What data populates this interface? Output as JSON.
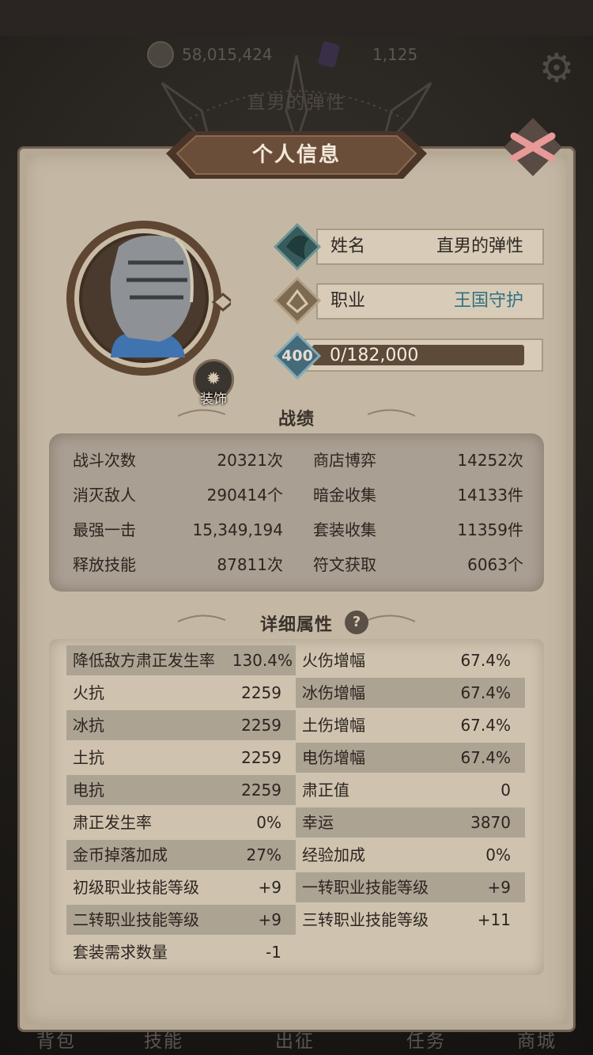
{
  "currency": {
    "gold": "58,015,424",
    "gems": "1,125"
  },
  "background_title": "直男的弹性",
  "panel": {
    "title": "个人信息"
  },
  "profile": {
    "decorate_label": "装饰",
    "name_label": "姓名",
    "name_value": "直男的弹性",
    "job_label": "职业",
    "job_value": "王国守护",
    "level": "400",
    "exp": "0/182,000",
    "exp_progress": 0
  },
  "records": {
    "title": "战绩",
    "items": [
      {
        "label": "战斗次数",
        "value": "20321次"
      },
      {
        "label": "商店博弈",
        "value": "14252次"
      },
      {
        "label": "消灭敌人",
        "value": "290414个"
      },
      {
        "label": "暗金收集",
        "value": "14133件"
      },
      {
        "label": "最强一击",
        "value": "15,349,194"
      },
      {
        "label": "套装收集",
        "value": "11359件"
      },
      {
        "label": "释放技能",
        "value": "87811次"
      },
      {
        "label": "符文获取",
        "value": "6063个"
      }
    ]
  },
  "attributes": {
    "title": "详细属性",
    "help": "?",
    "left": [
      {
        "label": "降低敌方肃正发生率",
        "value": "130.4%"
      },
      {
        "label": "火抗",
        "value": "2259"
      },
      {
        "label": "冰抗",
        "value": "2259"
      },
      {
        "label": "土抗",
        "value": "2259"
      },
      {
        "label": "电抗",
        "value": "2259"
      },
      {
        "label": "肃正发生率",
        "value": "0%"
      },
      {
        "label": "金币掉落加成",
        "value": "27%"
      },
      {
        "label": "初级职业技能等级",
        "value": "+9"
      },
      {
        "label": "二转职业技能等级",
        "value": "+9"
      },
      {
        "label": "套装需求数量",
        "value": "-1"
      }
    ],
    "right": [
      {
        "label": "火伤增幅",
        "value": "67.4%"
      },
      {
        "label": "冰伤增幅",
        "value": "67.4%"
      },
      {
        "label": "土伤增幅",
        "value": "67.4%"
      },
      {
        "label": "电伤增幅",
        "value": "67.4%"
      },
      {
        "label": "肃正值",
        "value": "0"
      },
      {
        "label": "幸运",
        "value": "3870"
      },
      {
        "label": "经验加成",
        "value": "0%"
      },
      {
        "label": "一转职业技能等级",
        "value": "+9"
      },
      {
        "label": "三转职业技能等级",
        "value": "+11"
      }
    ]
  },
  "tabs": [
    {
      "label": "背包"
    },
    {
      "label": "技能"
    },
    {
      "label": "出征"
    },
    {
      "label": "任务"
    },
    {
      "label": "商城"
    }
  ],
  "colors": {
    "accent_blue": "#31707f",
    "panel": "#c4b8a5",
    "banner": "#6b4e3a"
  }
}
